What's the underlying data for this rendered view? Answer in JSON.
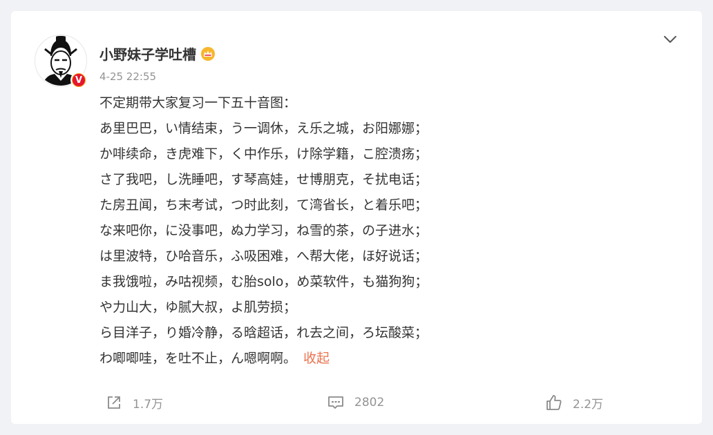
{
  "post": {
    "author": "小野妹子学吐槽",
    "verified_badge": "V",
    "time": "4-25 22:55",
    "lines": [
      "不定期带大家复习一下五十音图：",
      "あ里巴巴，い情结束，う一调休，え乐之城，お阳娜娜；",
      "か啡续命，き虎难下，く中作乐，け除学籍，こ腔溃疡；",
      "さ了我吧，し洗睡吧，す琴高娃，せ博朋克，そ扰电话；",
      "た房丑闻，ち末考试，つ时此刻，て湾省长，と着乐吧；",
      "な来吧你，に没事吧，ぬ力学习，ね雪的茶，の子进水；",
      "は里波特，ひ哈音乐，ふ吸困难，へ帮大佬，ほ好说话；",
      "ま我饿啦，み咕视频，む胎solo，め菜软件，も猫狗狗；",
      "や力山大，ゆ腻大叔，よ肌劳损；",
      "ら目洋子，り婚冷静，る晗超话，れ去之间，ろ坛酸菜；",
      "わ唧唧哇，を吐不止，ん嗯啊啊。"
    ],
    "collapse_label": "收起"
  },
  "actions": {
    "share_count": "1.7万",
    "comment_count": "2802",
    "like_count": "2.2万"
  },
  "colors": {
    "accent": "#eb7350",
    "muted": "#939393",
    "background": "#f1f2f5"
  }
}
